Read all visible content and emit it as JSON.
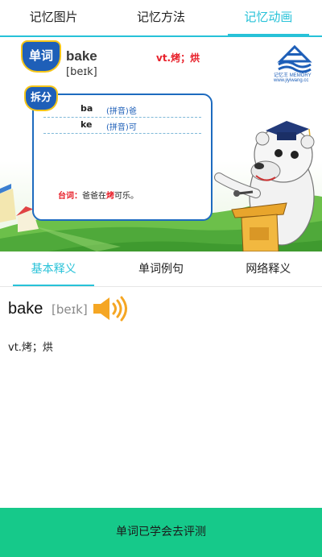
{
  "top_tabs": [
    {
      "label": "记忆图片",
      "active": false
    },
    {
      "label": "记忆方法",
      "active": false
    },
    {
      "label": "记忆动画",
      "active": true
    }
  ],
  "banner": {
    "word_badge": "单词",
    "word": "bake",
    "phonetic": "[beɪk]",
    "meaning": "vt.烤；烘",
    "split_badge": "拆分",
    "split_rows": [
      {
        "part": "ba",
        "hint_tag": "(拼音)",
        "hint_char": "爸"
      },
      {
        "part": "ke",
        "hint_tag": "(拼音)",
        "hint_char": "可"
      }
    ],
    "tagline_label": "台词：",
    "tagline_pre": "爸爸在",
    "tagline_highlight": "烤",
    "tagline_post": "可乐。",
    "logo_text": "记忆王",
    "logo_subtext": "MEMORY",
    "logo_url": "www.jiyiwang.cc"
  },
  "sub_tabs": [
    {
      "label": "基本释义",
      "active": true
    },
    {
      "label": "单词例句",
      "active": false
    },
    {
      "label": "网络释义",
      "active": false
    }
  ],
  "definition": {
    "word": "bake",
    "phonetic": "[beɪk]",
    "meaning": "vt.烤；烘"
  },
  "bottom_button": "单词已学会去评测",
  "colors": {
    "accent": "#27c2d8",
    "bottom_bar": "#16c98a",
    "badge_blue": "#1e5fb8",
    "highlight_red": "#e8202a",
    "speaker_orange": "#f5a623"
  }
}
